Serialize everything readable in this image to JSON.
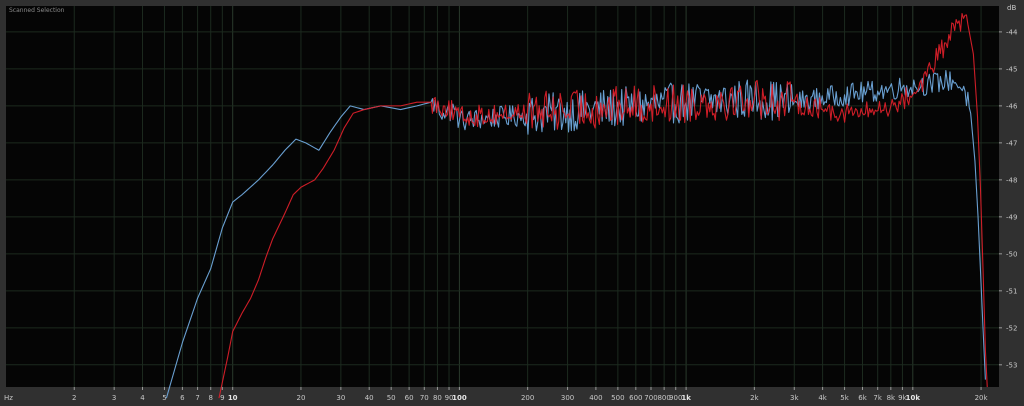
{
  "panel": {
    "title": "Scanned Selection"
  },
  "colors": {
    "background": "#050505",
    "frame": "#303030",
    "blue_series": "#6fa8dc",
    "red_series": "#e0202a"
  },
  "chart_data": {
    "type": "line",
    "title": "",
    "xlabel": "",
    "ylabel": "",
    "x_scale": "log",
    "xlim": [
      1,
      24000
    ],
    "ylim": [
      -53.6,
      -43.3
    ],
    "grid": true,
    "x_unit_label": "Hz",
    "y_unit_label": "dB",
    "x_ticks": [
      {
        "v": 2,
        "label": "2"
      },
      {
        "v": 3,
        "label": "3"
      },
      {
        "v": 4,
        "label": "4"
      },
      {
        "v": 5,
        "label": "5"
      },
      {
        "v": 6,
        "label": "6"
      },
      {
        "v": 7,
        "label": "7"
      },
      {
        "v": 8,
        "label": "8"
      },
      {
        "v": 9,
        "label": "9"
      },
      {
        "v": 10,
        "label": "10",
        "bold": true
      },
      {
        "v": 20,
        "label": "20"
      },
      {
        "v": 30,
        "label": "30"
      },
      {
        "v": 40,
        "label": "40"
      },
      {
        "v": 50,
        "label": "50"
      },
      {
        "v": 60,
        "label": "60"
      },
      {
        "v": 70,
        "label": "70"
      },
      {
        "v": 80,
        "label": "80"
      },
      {
        "v": 90,
        "label": "90"
      },
      {
        "v": 100,
        "label": "100",
        "bold": true
      },
      {
        "v": 200,
        "label": "200"
      },
      {
        "v": 300,
        "label": "300"
      },
      {
        "v": 400,
        "label": "400"
      },
      {
        "v": 500,
        "label": "500"
      },
      {
        "v": 600,
        "label": "600"
      },
      {
        "v": 700,
        "label": "700"
      },
      {
        "v": 800,
        "label": "800"
      },
      {
        "v": 900,
        "label": "900"
      },
      {
        "v": 1000,
        "label": "1k",
        "bold": true
      },
      {
        "v": 2000,
        "label": "2k"
      },
      {
        "v": 3000,
        "label": "3k"
      },
      {
        "v": 4000,
        "label": "4k"
      },
      {
        "v": 5000,
        "label": "5k"
      },
      {
        "v": 6000,
        "label": "6k"
      },
      {
        "v": 7000,
        "label": "7k"
      },
      {
        "v": 8000,
        "label": "8k"
      },
      {
        "v": 9000,
        "label": "9k"
      },
      {
        "v": 10000,
        "label": "10k",
        "bold": true
      },
      {
        "v": 20000,
        "label": "20k"
      }
    ],
    "y_ticks": [
      {
        "v": -44,
        "label": "-44"
      },
      {
        "v": -45,
        "label": "-45"
      },
      {
        "v": -46,
        "label": "-46"
      },
      {
        "v": -47,
        "label": "-47"
      },
      {
        "v": -48,
        "label": "-48"
      },
      {
        "v": -49,
        "label": "-49"
      },
      {
        "v": -50,
        "label": "-50"
      },
      {
        "v": -51,
        "label": "-51"
      },
      {
        "v": -52,
        "label": "-52"
      },
      {
        "v": -53,
        "label": "-53"
      }
    ],
    "series": [
      {
        "color": "#6fa8dc",
        "points": [
          [
            5.1,
            -53.9
          ],
          [
            6,
            -52.4
          ],
          [
            7,
            -51.2
          ],
          [
            8,
            -50.4
          ],
          [
            9,
            -49.3
          ],
          [
            10,
            -48.6
          ],
          [
            11,
            -48.4
          ],
          [
            13,
            -48.0
          ],
          [
            15,
            -47.6
          ],
          [
            17,
            -47.2
          ],
          [
            19,
            -46.9
          ],
          [
            21,
            -47.0
          ],
          [
            24,
            -47.2
          ],
          [
            27,
            -46.7
          ],
          [
            30,
            -46.3
          ],
          [
            33,
            -46.0
          ],
          [
            38,
            -46.1
          ],
          [
            45,
            -46.0
          ],
          [
            55,
            -46.1
          ],
          [
            65,
            -46.0
          ],
          [
            75,
            -45.9
          ],
          [
            85,
            -46.2
          ],
          [
            95,
            -46.1
          ],
          [
            100,
            -46.4
          ],
          [
            1000,
            -45.9
          ],
          [
            2000,
            -45.8
          ],
          [
            3000,
            -45.9
          ],
          [
            5000,
            -45.7
          ],
          [
            7000,
            -45.6
          ],
          [
            9000,
            -45.5
          ],
          [
            12000,
            -45.4
          ],
          [
            15000,
            -45.3
          ],
          [
            17000,
            -45.6
          ],
          [
            18000,
            -46.2
          ],
          [
            18800,
            -47.5
          ],
          [
            19400,
            -49.0
          ],
          [
            19900,
            -50.5
          ],
          [
            20400,
            -52.0
          ],
          [
            20900,
            -53.4
          ]
        ]
      },
      {
        "color": "#e0202a",
        "points": [
          [
            8.7,
            -53.9
          ],
          [
            9.5,
            -52.8
          ],
          [
            10,
            -52.1
          ],
          [
            11,
            -51.6
          ],
          [
            12,
            -51.2
          ],
          [
            13,
            -50.7
          ],
          [
            14,
            -50.1
          ],
          [
            15,
            -49.6
          ],
          [
            17,
            -48.9
          ],
          [
            18.5,
            -48.4
          ],
          [
            20,
            -48.2
          ],
          [
            23,
            -48.0
          ],
          [
            25,
            -47.7
          ],
          [
            28,
            -47.2
          ],
          [
            31,
            -46.6
          ],
          [
            34,
            -46.2
          ],
          [
            38,
            -46.1
          ],
          [
            45,
            -46.0
          ],
          [
            55,
            -46.0
          ],
          [
            65,
            -45.9
          ],
          [
            75,
            -45.9
          ],
          [
            85,
            -46.0
          ],
          [
            95,
            -46.2
          ],
          [
            100,
            -46.3
          ],
          [
            1000,
            -45.9
          ],
          [
            2000,
            -45.8
          ],
          [
            3000,
            -45.9
          ],
          [
            4000,
            -46.1
          ],
          [
            6000,
            -46.2
          ],
          [
            8000,
            -46.0
          ],
          [
            10000,
            -45.7
          ],
          [
            12000,
            -45.0
          ],
          [
            14000,
            -44.3
          ],
          [
            16000,
            -43.7
          ],
          [
            17500,
            -43.8
          ],
          [
            18500,
            -44.6
          ],
          [
            19300,
            -46.3
          ],
          [
            19900,
            -48.3
          ],
          [
            20400,
            -50.4
          ],
          [
            20900,
            -52.6
          ],
          [
            21300,
            -53.6
          ]
        ]
      }
    ]
  }
}
